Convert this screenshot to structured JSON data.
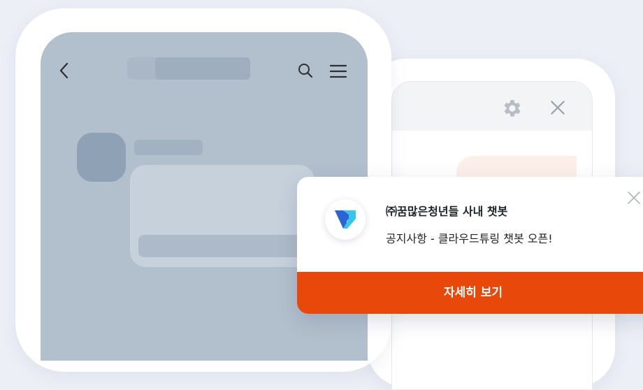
{
  "notification": {
    "title": "㈜꿈많은청년들 사내 챗봇",
    "message": "공지사항 - 클라우드튜링 챗봇 오픈!",
    "cta_label": "자세히 보기",
    "logo_icon": "cloud-turing-logo-icon",
    "close_icon": "close-icon"
  },
  "colors": {
    "background": "#eceff6",
    "accent": "#e8490b",
    "placeholder_screen": "#b2bfcd",
    "logo_blue": "#2b63d9",
    "logo_cyan": "#35c6e8"
  },
  "icons": {
    "front_phone": [
      "back-arrow-icon",
      "search-icon",
      "menu-icon"
    ],
    "back_phone": [
      "gear-icon",
      "close-icon"
    ]
  }
}
